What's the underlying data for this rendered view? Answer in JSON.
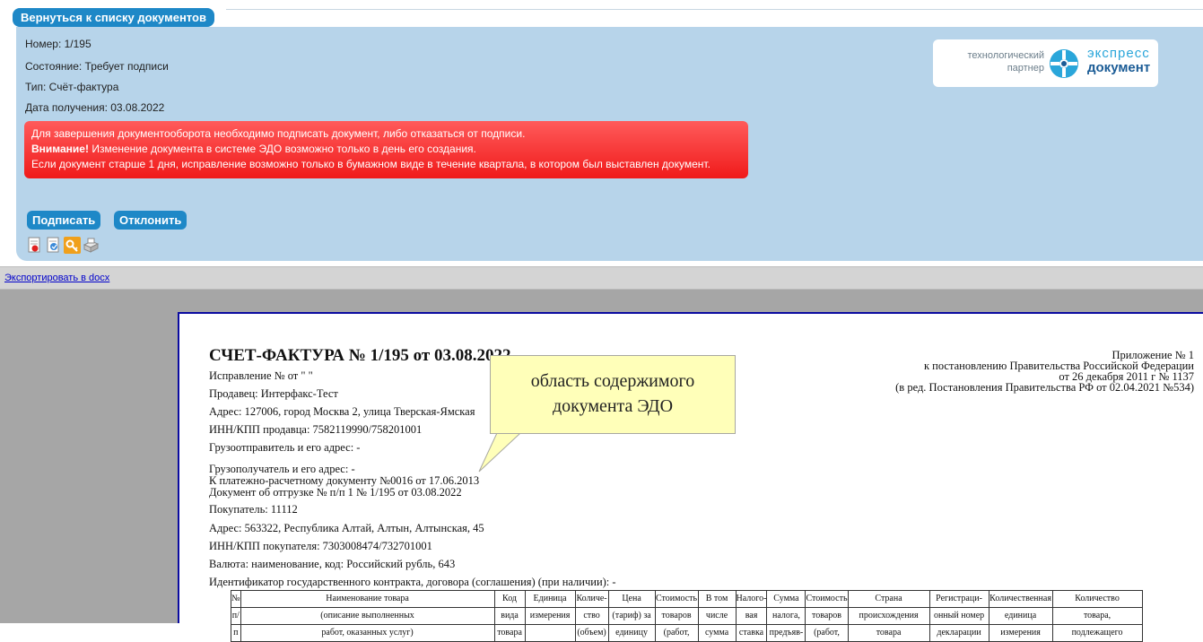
{
  "header": {
    "back_button": "Вернуться к списку документов"
  },
  "info": {
    "number": "Номер: 1/195",
    "status": "Состояние: Требует подписи",
    "type": "Тип: Счёт-фактура",
    "received": "Дата получения: 03.08.2022"
  },
  "logo": {
    "tech_line1": "технологический",
    "tech_line2": "партнер",
    "brand_line1": "экспресс",
    "brand_line2": "документ"
  },
  "alert": {
    "line1": "Для завершения документооборота необходимо подписать документ, либо отказаться от подписи.",
    "line2_bold": "Внимание!",
    "line2_rest": " Изменение документа в системе ЭДО возможно только в день его создания.",
    "line3": "Если документ старше 1 дня, исправление возможно только в бумажном виде в течение квартала, в котором был выставлен документ."
  },
  "actions": {
    "sign": "Подписать",
    "decline": "Отклонить"
  },
  "tools": [
    {
      "icon": "document-red-icon"
    },
    {
      "icon": "document-blue-icon"
    },
    {
      "icon": "key-icon"
    },
    {
      "icon": "print-icon"
    }
  ],
  "export": {
    "link": "Экспортировать в docx"
  },
  "document": {
    "title": "СЧЕТ-ФАКТУРА № 1/195 от 03.08.2022",
    "lines": [
      "Исправление №      от \"    \"",
      "Продавец: Интерфакс-Тест",
      "Адрес: 127006, город Москва 2, улица Тверская-Ямская",
      "ИНН/КПП продавца: 7582119990/758201001",
      "Грузоотправитель и его адрес: -",
      "Грузополучатель и его адрес: -",
      "К платежно-расчетному документу №0016 от 17.06.2013",
      "Документ об отгрузке № п/п 1 № 1/195 от 03.08.2022",
      "Покупатель: 11112",
      "Адрес: 563322, Республика Алтай, Алтын, Алтынская, 45",
      "ИНН/КПП покупателя: 7303008474/732701001",
      "Валюта: наименование, код: Российский рубль, 643",
      "Идентификатор государственного контракта, договора (соглашения) (при наличии): -"
    ],
    "appendix": [
      "Приложение № 1",
      "к постановлению Правительства Российской Федерации",
      "от 26 декабря 2011 г № 1137",
      "(в ред. Постановления Правительства РФ от 02.04.2021 №534)"
    ],
    "table_rows": [
      [
        "№",
        "Наименование товара",
        "Код",
        "Единица",
        "Количе-",
        "Цена",
        "Стоимость",
        "В том",
        "Налого-",
        "Сумма",
        "Стоимость",
        "Страна",
        "Регистраци-",
        "Количественная",
        "Количество"
      ],
      [
        "п/",
        "(описание выполненных",
        "вида",
        "измерения",
        "ство",
        "(тариф) за",
        "товаров",
        "числе",
        "вая",
        "налога,",
        "товаров",
        "происхождения",
        "онный номер",
        "единица",
        "товара,"
      ],
      [
        "п",
        "работ, оказанных услуг)",
        "товара",
        "",
        "(объем)",
        "единицу",
        "(работ,",
        "сумма",
        "ставка",
        "предъяв-",
        "(работ,",
        "товара",
        "декларации",
        "измерения",
        "подлежащего"
      ]
    ]
  },
  "callout": {
    "line1": "область содержимого",
    "line2": "документа ЭДО"
  }
}
